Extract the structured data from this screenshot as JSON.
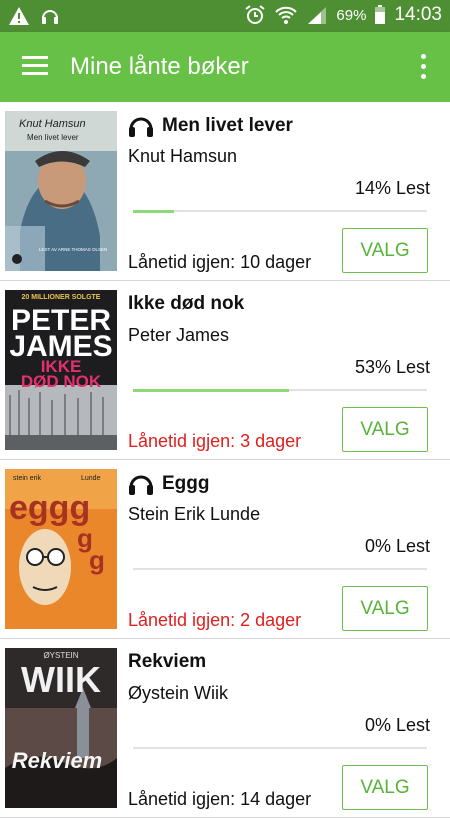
{
  "status_bar": {
    "battery": "69%",
    "time": "14:03",
    "icons": [
      "warning-icon",
      "headphones-icon",
      "alarm-icon",
      "wifi-icon",
      "signal-icon",
      "battery-icon"
    ]
  },
  "app_bar": {
    "title": "Mine lånte bøker",
    "menu_icon": "hamburger-menu-icon",
    "overflow_icon": "more-vert-icon"
  },
  "colors": {
    "status_bar": "#4e8f33",
    "app_bar": "#67c147",
    "accent": "#57b339",
    "progress_fill": "#8fd87c",
    "urgent": "#e0201e"
  },
  "books": [
    {
      "title": "Men livet lever",
      "author": "Knut Hamsun",
      "audiobook": true,
      "progress_label": "14% Lest",
      "progress": 0.14,
      "loan": "Lånetid igjen: 10 dager",
      "urgent": false,
      "button": "VALG",
      "cover": {
        "author": "Knut Hamsun",
        "title": "Men livet lever",
        "reader": "LEST AV ARNE THOMAS OLSEN"
      }
    },
    {
      "title": "Ikke død nok",
      "author": "Peter James",
      "audiobook": false,
      "progress_label": "53% Lest",
      "progress": 0.53,
      "loan": "Lånetid igjen: 3 dager",
      "urgent": true,
      "button": "VALG",
      "cover": {
        "banner": "20 MILLIONER SOLGTE",
        "author_line1": "PETER",
        "author_line2": "JAMES",
        "title_line1": "IKKE",
        "title_line2": "DØD NOK"
      }
    },
    {
      "title": "Eggg",
      "author": "Stein Erik Lunde",
      "audiobook": true,
      "progress_label": "0% Lest",
      "progress": 0,
      "loan": "Lånetid igjen: 2 dager",
      "urgent": true,
      "button": "VALG",
      "cover": {
        "author_first": "stein erik",
        "author_last": "Lunde",
        "title": "eggg"
      }
    },
    {
      "title": "Rekviem",
      "author": "Øystein Wiik",
      "audiobook": false,
      "progress_label": "0% Lest",
      "progress": 0,
      "loan": "Lånetid igjen: 14 dager",
      "urgent": false,
      "button": "VALG",
      "cover": {
        "author_first": "ØYSTEIN",
        "author_last": "WIIK",
        "title": "Rekviem"
      }
    }
  ]
}
